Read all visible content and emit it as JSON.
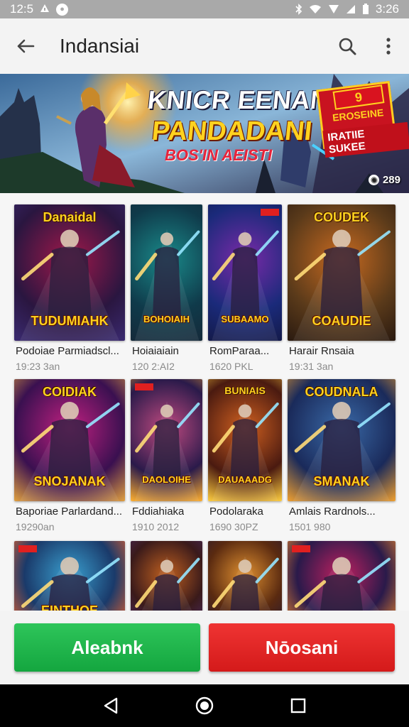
{
  "status_bar": {
    "time_left": "12:5",
    "time_right": "3:26"
  },
  "app_bar": {
    "title": "Indansiai"
  },
  "banner": {
    "title_line1": "KNICR EENANI",
    "title_line2": "PANDADANI",
    "title_line3": "BOS'IN AEISTI",
    "badge_top": "9",
    "badge_line1": "EROSEINE",
    "badge_line2": "IRATIIE SUKEE",
    "counter": "289"
  },
  "apps": [
    {
      "name": "Podoiae Parmiadscl...",
      "meta": "19:23 3an",
      "art_title": "Danaidal",
      "art_sub": "TUDUMIAHK",
      "colors": [
        "#2a1640",
        "#a0184a",
        "#3a2a70"
      ]
    },
    {
      "name": "Hoiaiaiain",
      "meta": "120 2:AI2",
      "art_title": "",
      "art_sub": "BOHOIAIH",
      "colors": [
        "#0f3a4a",
        "#1a8a8a",
        "#152a3a"
      ]
    },
    {
      "name": "RomParaa...",
      "meta": "1620 PKL",
      "art_title": "",
      "art_sub": "SUBAAMO",
      "colors": [
        "#1a2a7a",
        "#7a2aa8",
        "#141a4a"
      ]
    },
    {
      "name": "Harair Rnsaia",
      "meta": "19:31 3an",
      "art_title": "COUDEK",
      "art_sub": "COAUDIE",
      "colors": [
        "#5a3a1a",
        "#c86a20",
        "#2a1a10"
      ]
    },
    {
      "name": "Baporiae Parlardand...",
      "meta": "19290an",
      "art_title": "COIDIAK",
      "art_sub": "SNOJANAK",
      "colors": [
        "#3a1050",
        "#c02080",
        "#e0a040"
      ]
    },
    {
      "name": "Fddiahiaka",
      "meta": "1910 2012",
      "art_title": "",
      "art_sub": "DAOLOIHE",
      "colors": [
        "#2a1a4a",
        "#c04a80",
        "#ffb030"
      ]
    },
    {
      "name": "Podolaraka",
      "meta": "1690 30PZ",
      "art_title": "BUNIAIS",
      "art_sub": "DAUAAADG",
      "colors": [
        "#4a1a10",
        "#d06020",
        "#ffce40"
      ]
    },
    {
      "name": "Amlais Rardnols...",
      "meta": "1501 980",
      "art_title": "COUDNALA",
      "art_sub": "SMANAK",
      "colors": [
        "#1a2a5a",
        "#3a6aa8",
        "#f0a030"
      ]
    },
    {
      "name": "",
      "meta": "",
      "art_title": "",
      "art_sub": "EINTHOE",
      "colors": [
        "#1a3a6a",
        "#3aa0d0",
        "#e06030"
      ]
    },
    {
      "name": "",
      "meta": "",
      "art_title": "",
      "art_sub": "",
      "colors": [
        "#3a1a1a",
        "#c06020",
        "#4a2a60"
      ]
    },
    {
      "name": "",
      "meta": "",
      "art_title": "",
      "art_sub": "",
      "colors": [
        "#5a2a10",
        "#e09030",
        "#2a1a30"
      ]
    },
    {
      "name": "",
      "meta": "",
      "art_title": "",
      "art_sub": "",
      "colors": [
        "#2a1a4a",
        "#c02060",
        "#e08030"
      ]
    }
  ],
  "buttons": {
    "primary": "Aleabnk",
    "secondary": "Nōosani"
  }
}
